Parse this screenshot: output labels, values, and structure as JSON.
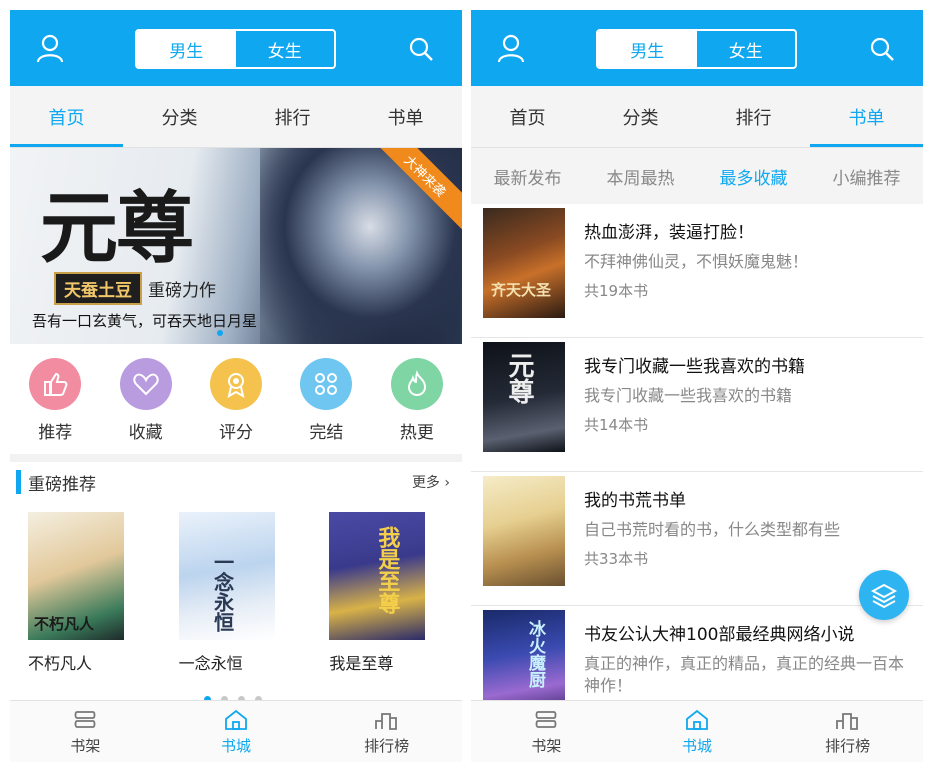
{
  "colors": {
    "accent": "#0fa8f0",
    "orange_ribbon": "#f08a1c"
  },
  "left": {
    "topbar": {
      "gender_male": "男生",
      "gender_female": "女生"
    },
    "tabs": [
      {
        "label": "首页"
      },
      {
        "label": "分类"
      },
      {
        "label": "排行"
      },
      {
        "label": "书单"
      }
    ],
    "banner": {
      "title": "元尊",
      "author": "天蚕土豆",
      "author_sub": "重磅力作",
      "tagline": "吾有一口玄黄气，可吞天地日月星",
      "ribbon": "大神来袭"
    },
    "quick": [
      {
        "label": "推荐",
        "icon": "thumbs-up-icon",
        "color": "#f28ca0"
      },
      {
        "label": "收藏",
        "icon": "heart-icon",
        "color": "#b99be0"
      },
      {
        "label": "评分",
        "icon": "award-icon",
        "color": "#f5c24e"
      },
      {
        "label": "完结",
        "icon": "grid-icon",
        "color": "#6fc6f0"
      },
      {
        "label": "热更",
        "icon": "flame-icon",
        "color": "#7fd6a4"
      }
    ],
    "featured": {
      "title": "重磅推荐",
      "more": "更多",
      "books": [
        {
          "title": "不朽凡人",
          "cover_text": "不朽凡人"
        },
        {
          "title": "一念永恒",
          "cover_text": "一念永恒"
        },
        {
          "title": "我是至尊",
          "cover_text": "我是至尊"
        }
      ]
    },
    "bottomnav": [
      {
        "label": "书架"
      },
      {
        "label": "书城"
      },
      {
        "label": "排行榜"
      }
    ]
  },
  "right": {
    "topbar": {
      "gender_male": "男生",
      "gender_female": "女生"
    },
    "tabs": [
      {
        "label": "首页"
      },
      {
        "label": "分类"
      },
      {
        "label": "排行"
      },
      {
        "label": "书单"
      }
    ],
    "subtabs": [
      {
        "label": "最新发布"
      },
      {
        "label": "本周最热"
      },
      {
        "label": "最多收藏"
      },
      {
        "label": "小编推荐"
      }
    ],
    "booklists": [
      {
        "title": "热血澎湃，装逼打脸！",
        "desc": "不拜神佛仙灵，不惧妖魔鬼魅！",
        "count": "共19本书",
        "cover_text": "齐天大圣"
      },
      {
        "title": "我专门收藏一些我喜欢的书籍",
        "desc": "我专门收藏一些我喜欢的书籍",
        "count": "共14本书",
        "cover_text": "元尊"
      },
      {
        "title": "我的书荒书单",
        "desc": "自己书荒时看的书，什么类型都有些",
        "count": "共33本书",
        "cover_text": ""
      },
      {
        "title": "书友公认大神100部最经典网络小说",
        "desc": "真正的神作，真正的精品，真正的经典一百本神作！",
        "count": "",
        "cover_text": "冰火魔厨"
      }
    ],
    "bottomnav": [
      {
        "label": "书架"
      },
      {
        "label": "书城"
      },
      {
        "label": "排行榜"
      }
    ]
  }
}
